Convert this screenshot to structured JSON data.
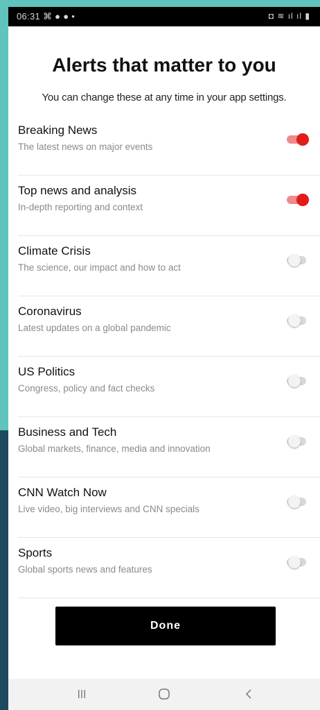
{
  "status_bar": {
    "time": "06:31",
    "left_icons": "⌘ ● ● •",
    "right_icons": "◘ ≋ ıl ıl ▮"
  },
  "header": {
    "title": "Alerts that matter to you",
    "subtitle": "You can change these at any time in your app settings."
  },
  "alerts": [
    {
      "title": "Breaking News",
      "description": "The latest news on major events",
      "enabled": true
    },
    {
      "title": "Top news and analysis",
      "description": "In-depth reporting and context",
      "enabled": true
    },
    {
      "title": "Climate Crisis",
      "description": "The science, our impact and how to act",
      "enabled": false
    },
    {
      "title": "Coronavirus",
      "description": "Latest updates on a global pandemic",
      "enabled": false
    },
    {
      "title": "US Politics",
      "description": "Congress, policy and fact checks",
      "enabled": false
    },
    {
      "title": "Business and Tech",
      "description": "Global markets, finance, media and innovation",
      "enabled": false
    },
    {
      "title": "CNN Watch Now",
      "description": "Live video, big interviews and CNN specials",
      "enabled": false
    },
    {
      "title": "Sports",
      "description": "Global sports news and features",
      "enabled": false
    }
  ],
  "done_label": "Done",
  "nav": {
    "recents_icon": "recent-apps-icon",
    "home_icon": "home-icon",
    "back_icon": "back-icon"
  },
  "colors": {
    "toggle_on": "#e21b1b",
    "toggle_on_track": "#f08a8a",
    "button_bg": "#000000",
    "backdrop_teal": "#5fc4bc",
    "backdrop_navy": "#1d4a5e"
  }
}
